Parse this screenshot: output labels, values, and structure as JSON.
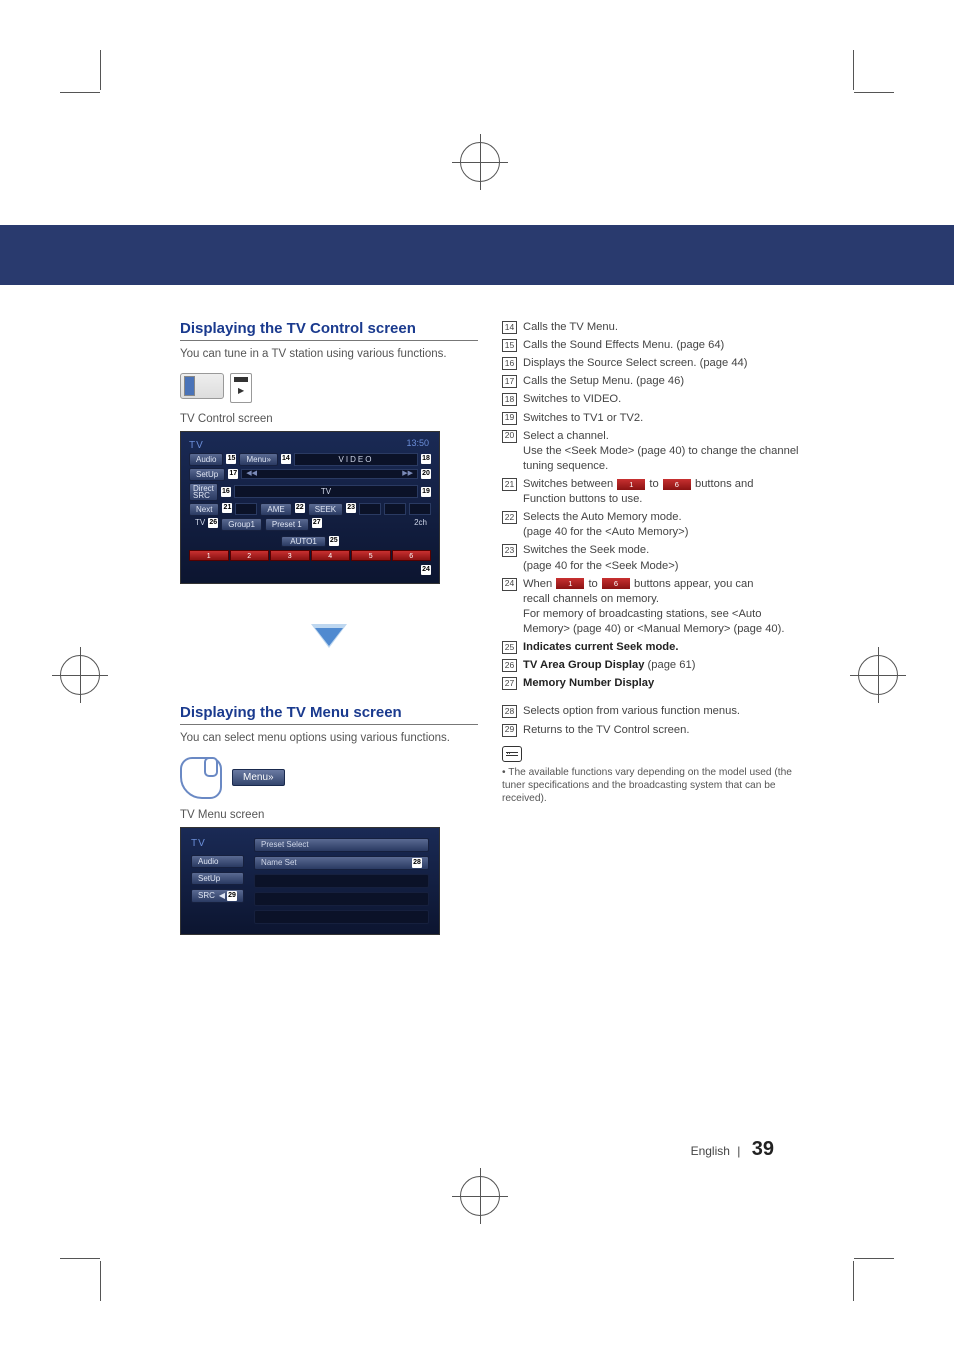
{
  "section1": {
    "title": "Displaying the TV Control screen",
    "intro": "You can tune in a TV station using various functions.",
    "screen_caption": "TV Control screen",
    "tv": {
      "header": "TV",
      "time": "13:50",
      "menu_label": "Menu»",
      "video_label": "VIDEO",
      "audio_label": "Audio",
      "setup_label": "SetUp",
      "direct_src_label": "Direct\nSRC",
      "next_label": "Next",
      "tv_label": "TV",
      "ame_label": "AME",
      "seek_label": "SEEK",
      "group_label": "Group1",
      "preset_label": "Preset 1",
      "ch_label": "2ch",
      "auto_label": "AUTO1",
      "preset_buttons": [
        "1",
        "2",
        "3",
        "4",
        "5",
        "6"
      ],
      "badges": {
        "b14": "14",
        "b15": "15",
        "b16": "16",
        "b17": "17",
        "b18": "18",
        "b19": "19",
        "b20": "20",
        "b21": "21",
        "b22": "22",
        "b23": "23",
        "b24": "24",
        "b25": "25",
        "b26": "26",
        "b27": "27"
      }
    }
  },
  "callouts1": {
    "c14": "Calls the TV Menu.",
    "c15": "Calls the Sound Effects Menu. (page 64)",
    "c16": "Displays the Source Select screen. (page 44)",
    "c17": "Calls the Setup Menu. (page 46)",
    "c18": "Switches to VIDEO.",
    "c19": "Switches to TV1 or TV2.",
    "c20a": "Select a channel.",
    "c20b": "Use the <Seek Mode> (page 40) to change the channel tuning sequence.",
    "c21a_pre": "Switches between",
    "c21a_mid": "to",
    "c21a_post": "buttons and",
    "c21b": "Function buttons to use.",
    "c22a": "Selects the Auto Memory mode.",
    "c22b": "(page 40 for the <Auto Memory>)",
    "c23a": "Switches the Seek mode.",
    "c23b": "(page 40 for the <Seek Mode>)",
    "c24a_pre": "When",
    "c24a_mid": "to",
    "c24a_post": "buttons appear, you can",
    "c24b": "recall channels on memory.",
    "c24c": "For memory of broadcasting stations, see <Auto Memory> (page 40) or <Manual Memory> (page 40).",
    "c25": "Indicates current Seek mode.",
    "c26_pre": "TV Area Group Display",
    "c26_post": " (page 61)",
    "c27": "Memory Number Display",
    "chip1": "1",
    "chip6": "6"
  },
  "section2": {
    "title": "Displaying the TV Menu screen",
    "intro": "You can select menu options using various functions.",
    "menu_pill": "Menu»",
    "screen_caption": "TV Menu screen",
    "menu": {
      "header": "TV",
      "audio": "Audio",
      "setup": "SetUp",
      "src": "SRC",
      "preset_select": "Preset Select",
      "name_set": "Name Set",
      "badges": {
        "b28": "28",
        "b29": "29"
      }
    }
  },
  "callouts2": {
    "c28": "Selects option from various function menus.",
    "c29": "Returns to the TV Control screen.",
    "note": "The available functions vary depending on the model used (the tuner specifications and the broadcasting system that can be received)."
  },
  "footer": {
    "lang": "English",
    "page": "39"
  }
}
